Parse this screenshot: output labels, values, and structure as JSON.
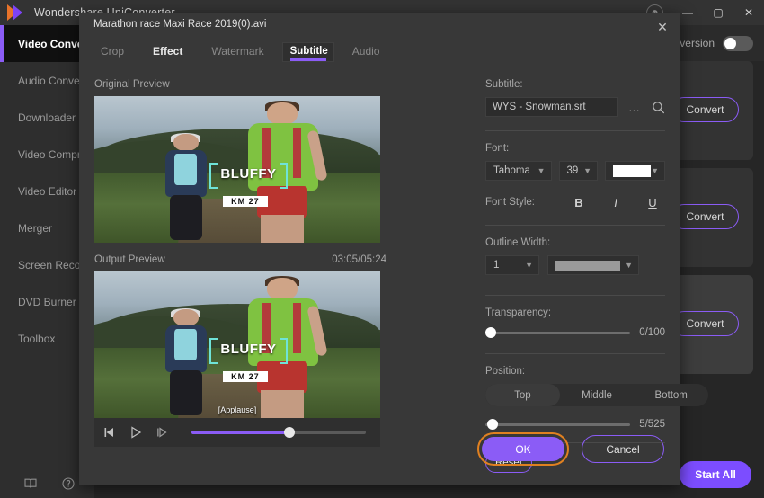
{
  "window": {
    "title": "Wondershare UniConverter",
    "logo": "play-triangle-logo",
    "controls": {
      "avatar": "account-avatar",
      "minimize": "—",
      "maximize": "▢",
      "close": "✕"
    }
  },
  "sidebar": {
    "items": [
      {
        "label": "Video Converter",
        "active": true
      },
      {
        "label": "Audio Converter",
        "active": false
      },
      {
        "label": "Downloader",
        "active": false
      },
      {
        "label": "Video Compressor",
        "active": false
      },
      {
        "label": "Video Editor",
        "active": false
      },
      {
        "label": "Merger",
        "active": false
      },
      {
        "label": "Screen Recorder",
        "active": false
      },
      {
        "label": "DVD Burner",
        "active": false
      },
      {
        "label": "Toolbox",
        "active": false
      }
    ],
    "bottom_icons": [
      "book-icon",
      "help-icon"
    ]
  },
  "content": {
    "conversion_toggle_label": "Conversion",
    "conversion_toggle_on": true,
    "convert_buttons": [
      "Convert",
      "Convert",
      "Convert"
    ],
    "start_all_label": "Start All"
  },
  "modal": {
    "file_name": "Marathon race  Maxi Race 2019(0).avi",
    "close_label": "✕",
    "tabs": [
      {
        "label": "Crop",
        "state": "dim"
      },
      {
        "label": "Effect",
        "state": "lit"
      },
      {
        "label": "Watermark",
        "state": "dim"
      },
      {
        "label": "Subtitle",
        "state": "selected"
      },
      {
        "label": "Audio",
        "state": "dim"
      }
    ],
    "original_preview": {
      "title": "Original Preview",
      "overlay_title": "BLUFFY",
      "overlay_chip": "KM 27"
    },
    "output_preview": {
      "title": "Output Preview",
      "timecode": "03:05/05:24",
      "overlay_title": "BLUFFY",
      "overlay_chip": "KM 27",
      "subtitle_text": "[Applause]"
    },
    "player": {
      "prev_frame_icon": "step-back-icon",
      "play_icon": "play-icon",
      "next_frame_icon": "step-forward-icon",
      "progress_percent": 56
    },
    "settings": {
      "subtitle_label": "Subtitle:",
      "subtitle_file": "WYS - Snowman.srt",
      "browse_icon": "ellipsis-icon",
      "search_icon": "search-icon",
      "font_label": "Font:",
      "font_family": "Tahoma",
      "font_size": "39",
      "font_color": "#ffffff",
      "font_style_label": "Font Style:",
      "bold_label": "B",
      "italic_label": "I",
      "underline_label": "U",
      "outline_label": "Outline Width:",
      "outline_width": "1",
      "outline_color": "#9a9a9a",
      "transparency_label": "Transparency:",
      "transparency_value": "0/100",
      "transparency_percent": 0,
      "position_label": "Position:",
      "position_options": [
        {
          "label": "Top",
          "active": true
        },
        {
          "label": "Middle",
          "active": false
        },
        {
          "label": "Bottom",
          "active": false
        }
      ],
      "position_value": "5/525",
      "position_percent": 1,
      "reset_label": "Reset",
      "ok_label": "OK",
      "cancel_label": "Cancel"
    }
  },
  "colors": {
    "accent_purple": "#8b5cf6",
    "focus_orange": "#e08020",
    "window_bg": "#2b2b2b",
    "modal_bg": "#383838"
  }
}
